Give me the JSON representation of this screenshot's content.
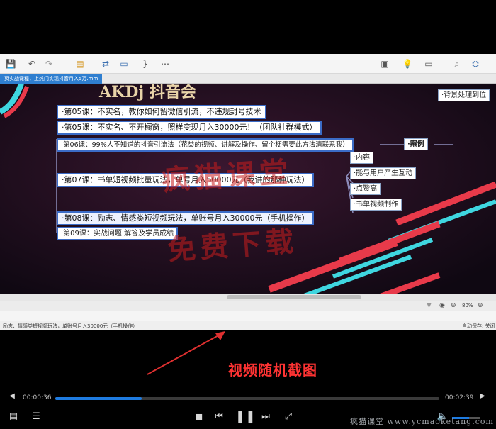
{
  "document_tab": "页实战课程，上热门实现抖音月入5万.mm",
  "map": {
    "header_fragment": "AKDj 抖音会",
    "topics": [
      "·第05课：不实名，教你如何留微信引流，不违规封号技术",
      "·第05课：不实名、不开橱窗，照样变现月入30000元！（团队社群模式）",
      "·第06课：99%人不知道的抖音引流法（花类的视频、讲解及操作、留个梗需要此方法清联系我）",
      "·第07课：书单短视频批量玩法，单号月入50000元（我讲的那种玩法）",
      "·第08课：励志、情感类短视频玩法，单账号月入30000元（手机操作）",
      "·第09课：实战问题 解答及学员成绩"
    ],
    "case_label": "·案例",
    "subtopics": [
      "·内容",
      "·能与用户产生互动",
      "·点赞高",
      "·书单视频制作"
    ],
    "right_topics": [
      "·背景处理到位"
    ],
    "watermark_line1": "疯猫课堂",
    "watermark_line2": "免费下载"
  },
  "status": {
    "zoom": "80%",
    "note": "励志、情感类短视频玩法，单账号月入30000元（手机操作）",
    "autosave": "自动保存: 关闭"
  },
  "annotation": "视频随机截图",
  "player": {
    "time_current": "00:00:36",
    "time_total": "00:02:39",
    "progress": 0.226
  },
  "brand": "疯猫课堂 www.ycmaoketang.com"
}
